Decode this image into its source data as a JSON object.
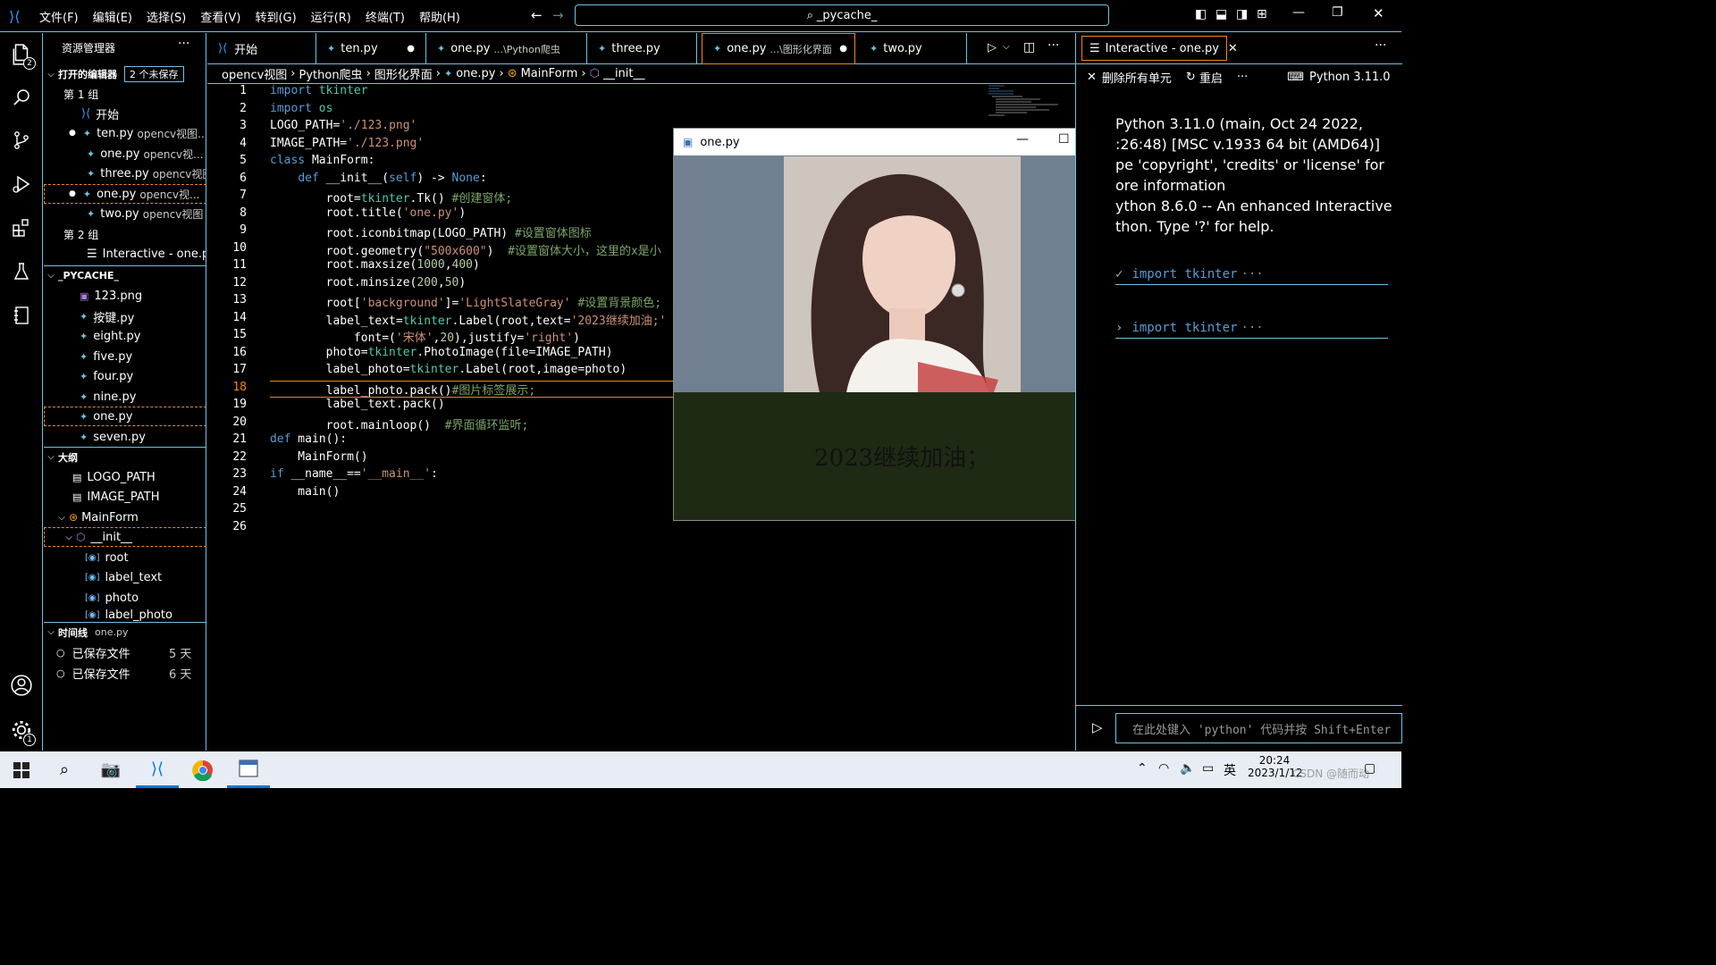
{
  "menu": [
    "文件(F)",
    "编辑(E)",
    "选择(S)",
    "查看(V)",
    "转到(G)",
    "运行(R)",
    "终端(T)",
    "帮助(H)"
  ],
  "command_center": "_pycache_",
  "activity_badges": {
    "explorer": "2",
    "settings": "1"
  },
  "sidebar": {
    "title": "资源管理器",
    "open_editors": {
      "header": "打开的编辑器",
      "unsaved": "2 个未保存",
      "group1": "第 1 组",
      "group2": "第 2 组",
      "items": [
        {
          "name": "开始",
          "path": ""
        },
        {
          "name": "ten.py",
          "path": "opencv视图..."
        },
        {
          "name": "one.py",
          "path": "opencv视..."
        },
        {
          "name": "three.py",
          "path": "opencv视图"
        },
        {
          "name": "one.py",
          "path": "opencv视..."
        },
        {
          "name": "two.py",
          "path": "opencv视图"
        }
      ],
      "interactive": "Interactive - one.py"
    },
    "folder": {
      "header": "_PYCACHE_",
      "files": [
        "123.png",
        "按键.py",
        "eight.py",
        "five.py",
        "four.py",
        "nine.py",
        "one.py",
        "seven.py"
      ]
    },
    "outline": {
      "header": "大纲",
      "items": [
        "LOGO_PATH",
        "IMAGE_PATH",
        "MainForm",
        "__init__",
        "root",
        "label_text",
        "photo",
        "label_photo"
      ]
    },
    "timeline": {
      "header": "时间线",
      "file": "one.py",
      "items": [
        {
          "label": "已保存文件",
          "age": "5 天"
        },
        {
          "label": "已保存文件",
          "age": "6 天"
        }
      ]
    }
  },
  "tabs": [
    {
      "label": "开始",
      "sub": ""
    },
    {
      "label": "ten.py",
      "sub": ""
    },
    {
      "label": "one.py",
      "sub": "...\\Python爬虫"
    },
    {
      "label": "three.py",
      "sub": ""
    },
    {
      "label": "one.py",
      "sub": "...\\图形化界面"
    },
    {
      "label": "two.py",
      "sub": ""
    }
  ],
  "breadcrumb": [
    "opencv视图",
    "Python爬虫",
    "图形化界面",
    "one.py",
    "MainForm",
    "__init__"
  ],
  "code_lines": [
    "import tkinter",
    "import os",
    "LOGO_PATH='./123.png'",
    "IMAGE_PATH='./123.png'",
    "class MainForm:",
    "    def __init__(self) -> None:",
    "        root=tkinter.Tk() #创建窗体;",
    "        root.title('one.py')",
    "        root.iconbitmap(LOGO_PATH) #设置窗体图标",
    "        root.geometry(\"500x600\")  #设置窗体大小，这里的x是小",
    "        root.maxsize(1000,400)",
    "        root.minsize(200,50)",
    "        root['background']='LightSlateGray' #设置背景颜色;",
    "        label_text=tkinter.Label(root,text='2023继续加油;'",
    "            font=('宋体',20),justify='right')",
    "        photo=tkinter.PhotoImage(file=IMAGE_PATH)",
    "        label_photo=tkinter.Label(root,image=photo)",
    "        label_photo.pack()#图片标签展示;",
    "        label_text.pack()",
    "        root.mainloop()  #界面循环监听;",
    "def main():",
    "    MainForm()",
    "if __name__=='__main__':",
    "    main()",
    "",
    ""
  ],
  "current_line": 18,
  "tk_window": {
    "title": "one.py",
    "label_text": "2023继续加油；",
    "background": "#708090"
  },
  "interactive": {
    "tab": "Interactive - one.py",
    "clear_all": "删除所有单元",
    "restart": "重启",
    "kernel": "Python 3.11.0",
    "banner": [
      "Python 3.11.0 (main, Oct 24 2022,",
      ":26:48) [MSC v.1933 64 bit (AMD64)]",
      "pe 'copyright', 'credits' or 'license' for",
      "ore information",
      "ython 8.6.0 -- An enhanced Interactive",
      "thon. Type '?' for help."
    ],
    "cells": [
      "import tkinter",
      "import tkinter"
    ],
    "input_placeholder": "在此处键入 'python' 代码并按 Shift+Enter"
  },
  "taskbar": {
    "ime": "英",
    "time": "20:24",
    "date": "2023/1/12",
    "watermark": "CSDN @随而动"
  },
  "colors": {
    "accent_border": "#6fc3df",
    "focus": "#f38518",
    "keyword": "#569cd6",
    "string": "#ce9178",
    "comment": "#7ca668"
  }
}
